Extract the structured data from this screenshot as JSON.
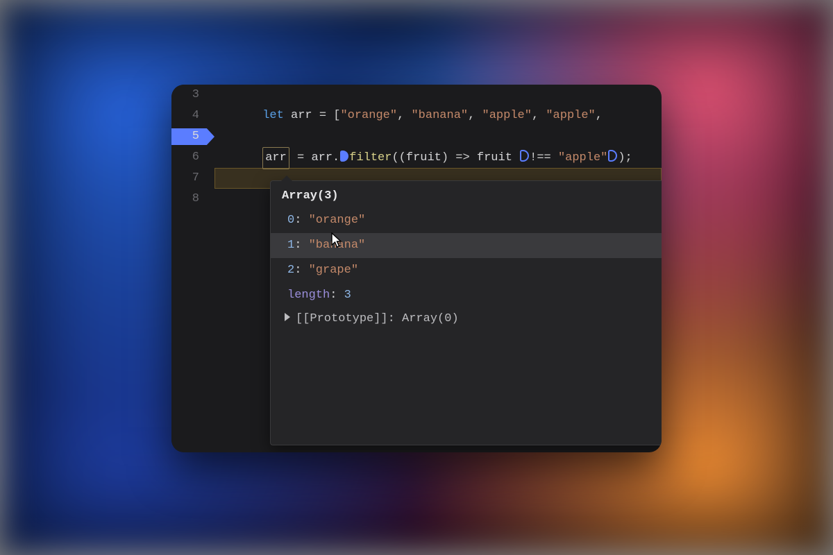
{
  "gutter": {
    "lines": [
      "3",
      "4",
      "5",
      "6",
      "7",
      "8"
    ],
    "current_line_index": 2
  },
  "code": {
    "line3": {
      "let": "let",
      "ident": "arr",
      "eq": " = ",
      "open": "[",
      "s0": "\"orange\"",
      "c": ", ",
      "s1": "\"banana\"",
      "s2": "\"apple\"",
      "s3": "\"apple\"",
      "trail": ", "
    },
    "line5": {
      "lhs": "arr",
      "eq": " = ",
      "rhs1": "arr",
      "dot": ".",
      "fn": "filter",
      "args_open": "((",
      "param": "fruit",
      "arrow": ") => ",
      "param2": "fruit ",
      "neq": "!== ",
      "literal": "\"apple\"",
      "close": ");"
    }
  },
  "tooltip": {
    "title": "Array(3)",
    "entries": [
      {
        "idx": "0",
        "sep": ": ",
        "val": "\"orange\""
      },
      {
        "idx": "1",
        "sep": ": ",
        "val": "\"banana\""
      },
      {
        "idx": "2",
        "sep": ": ",
        "val": "\"grape\""
      }
    ],
    "length_key": "length",
    "length_sep": ": ",
    "length_val": "3",
    "proto_key": "[[Prototype]]",
    "proto_sep": ": ",
    "proto_val": "Array(0)"
  }
}
